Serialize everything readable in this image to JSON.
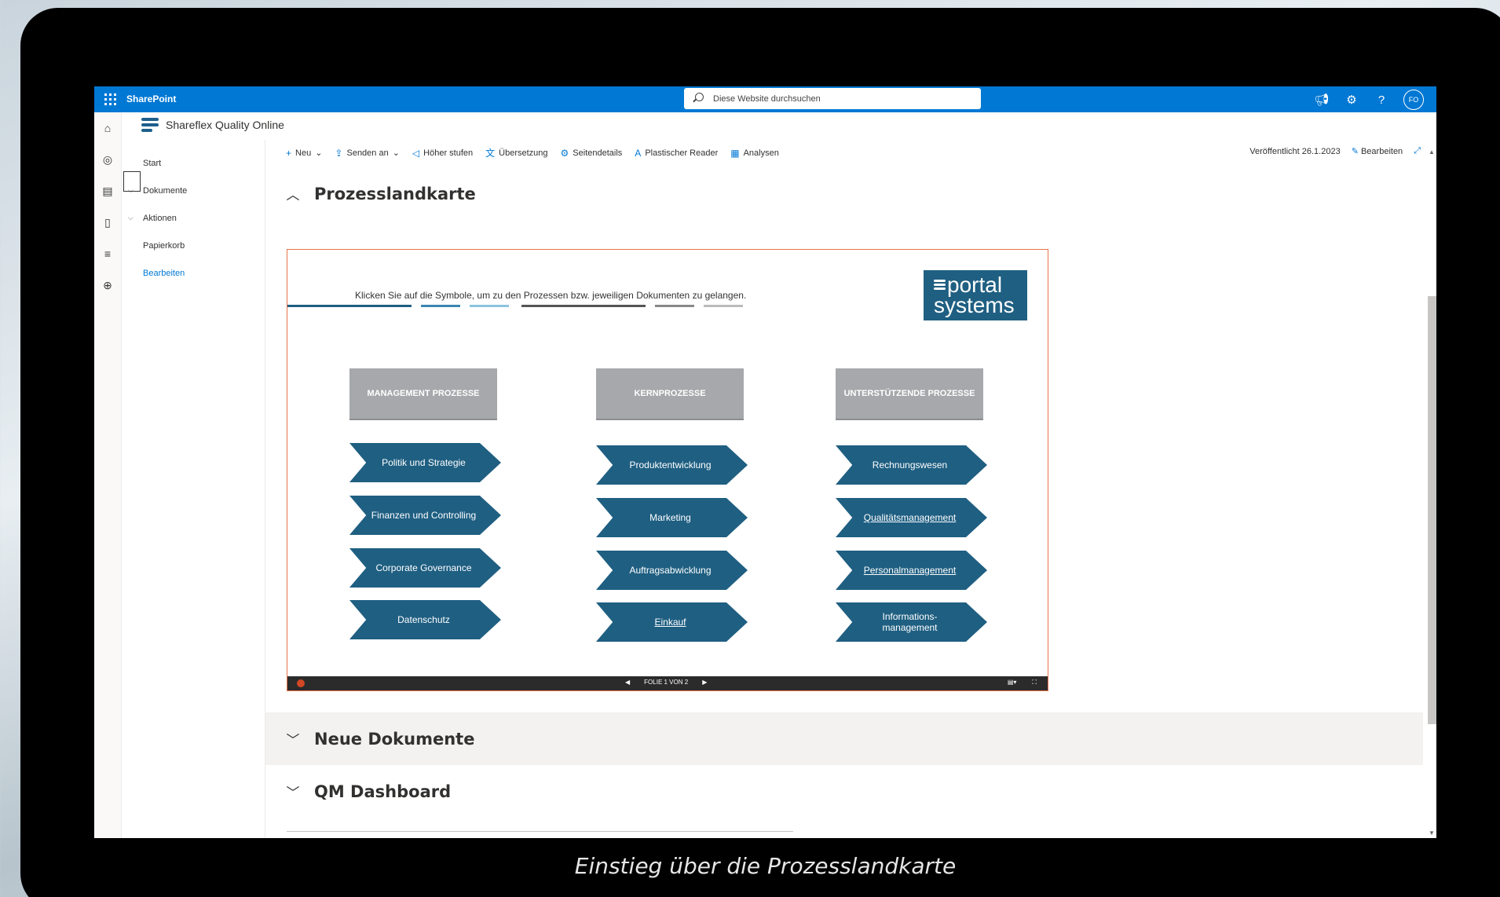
{
  "suite_bar": {
    "app_name": "SharePoint",
    "search_placeholder": "Diese Website durchsuchen",
    "user_initials": "FO"
  },
  "site": {
    "title": "Shareflex Quality Online"
  },
  "left_nav": {
    "items": [
      {
        "label": "Start",
        "link": false
      },
      {
        "label": "Dokumente",
        "link": false
      },
      {
        "label": "Aktionen",
        "link": false
      },
      {
        "label": "Papierkorb",
        "link": false
      },
      {
        "label": "Bearbeiten",
        "link": true
      }
    ]
  },
  "command_bar": {
    "new": "Neu",
    "send_to": "Senden an",
    "promote": "Höher stufen",
    "translation": "Übersetzung",
    "page_details": "Seitendetails",
    "immersive_reader": "Plastischer Reader",
    "analytics": "Analysen",
    "published": "Veröffentlicht 26.1.2023",
    "edit": "Bearbeiten"
  },
  "sections": {
    "process_map": "Prozesslandkarte",
    "new_documents": "Neue Dokumente",
    "qm_dashboard": "QM Dashboard"
  },
  "slide": {
    "intro": "Klicken Sie auf die Symbole, um zu den Prozessen bzw. jeweiligen Dokumenten zu gelangen.",
    "logo_line1": "portal",
    "logo_line2": "systems",
    "columns": [
      {
        "header": "MANAGEMENT PROZESSE",
        "items": [
          "Politik und Strategie",
          "Finanzen und Controlling",
          "Corporate Governance",
          "Datenschutz"
        ]
      },
      {
        "header": "KERNPROZESSE",
        "items": [
          "Produktentwicklung",
          "Marketing",
          "Auftragsabwicklung",
          "Einkauf"
        ]
      },
      {
        "header": "UNTERSTÜTZENDE PROZESSE",
        "items": [
          "Rechnungswesen",
          "Qualitätsmanagement",
          "Personalmanagement",
          "Informations- management"
        ]
      }
    ],
    "footer_label": "FOLIE 1 VON 2",
    "accent_color": "#1f5f82"
  },
  "caption": "Einstieg über die Prozesslandkarte"
}
